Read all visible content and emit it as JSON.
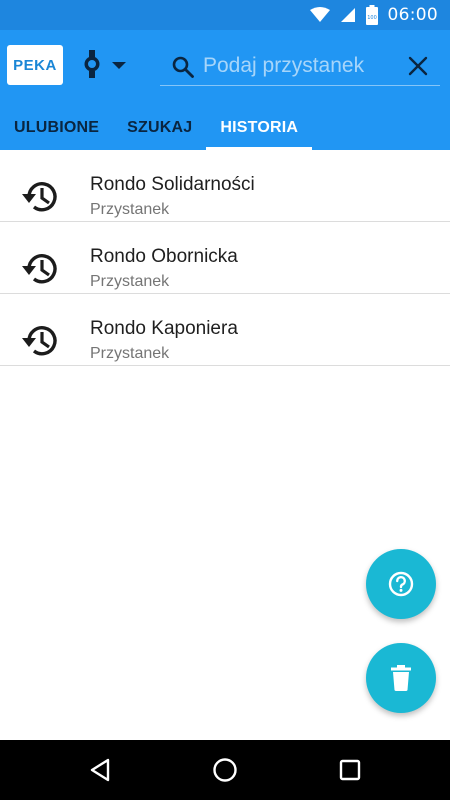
{
  "status_bar": {
    "time": "06:00",
    "battery_text": "100",
    "icons": [
      "wifi-icon",
      "signal-icon",
      "battery-icon"
    ]
  },
  "app_bar": {
    "logo_text": "PEKA",
    "mode_icon": "watch-icon",
    "search": {
      "placeholder": "Podaj przystanek",
      "value": ""
    },
    "tabs": [
      {
        "label": "ULUBIONE",
        "active": false
      },
      {
        "label": "SZUKAJ",
        "active": false
      },
      {
        "label": "HISTORIA",
        "active": true
      }
    ]
  },
  "history": {
    "items": [
      {
        "title": "Rondo Solidarności",
        "subtitle": "Przystanek",
        "icon": "history-icon"
      },
      {
        "title": "Rondo Obornicka",
        "subtitle": "Przystanek",
        "icon": "history-icon"
      },
      {
        "title": "Rondo Kaponiera",
        "subtitle": "Przystanek",
        "icon": "history-icon"
      }
    ]
  },
  "fabs": {
    "help_icon": "help-circle-icon",
    "delete_icon": "trash-icon"
  },
  "colors": {
    "status_bar": "#1e86df",
    "primary": "#2196f3",
    "accent": "#1ab8d4",
    "tab_inactive": "#0a2540"
  }
}
